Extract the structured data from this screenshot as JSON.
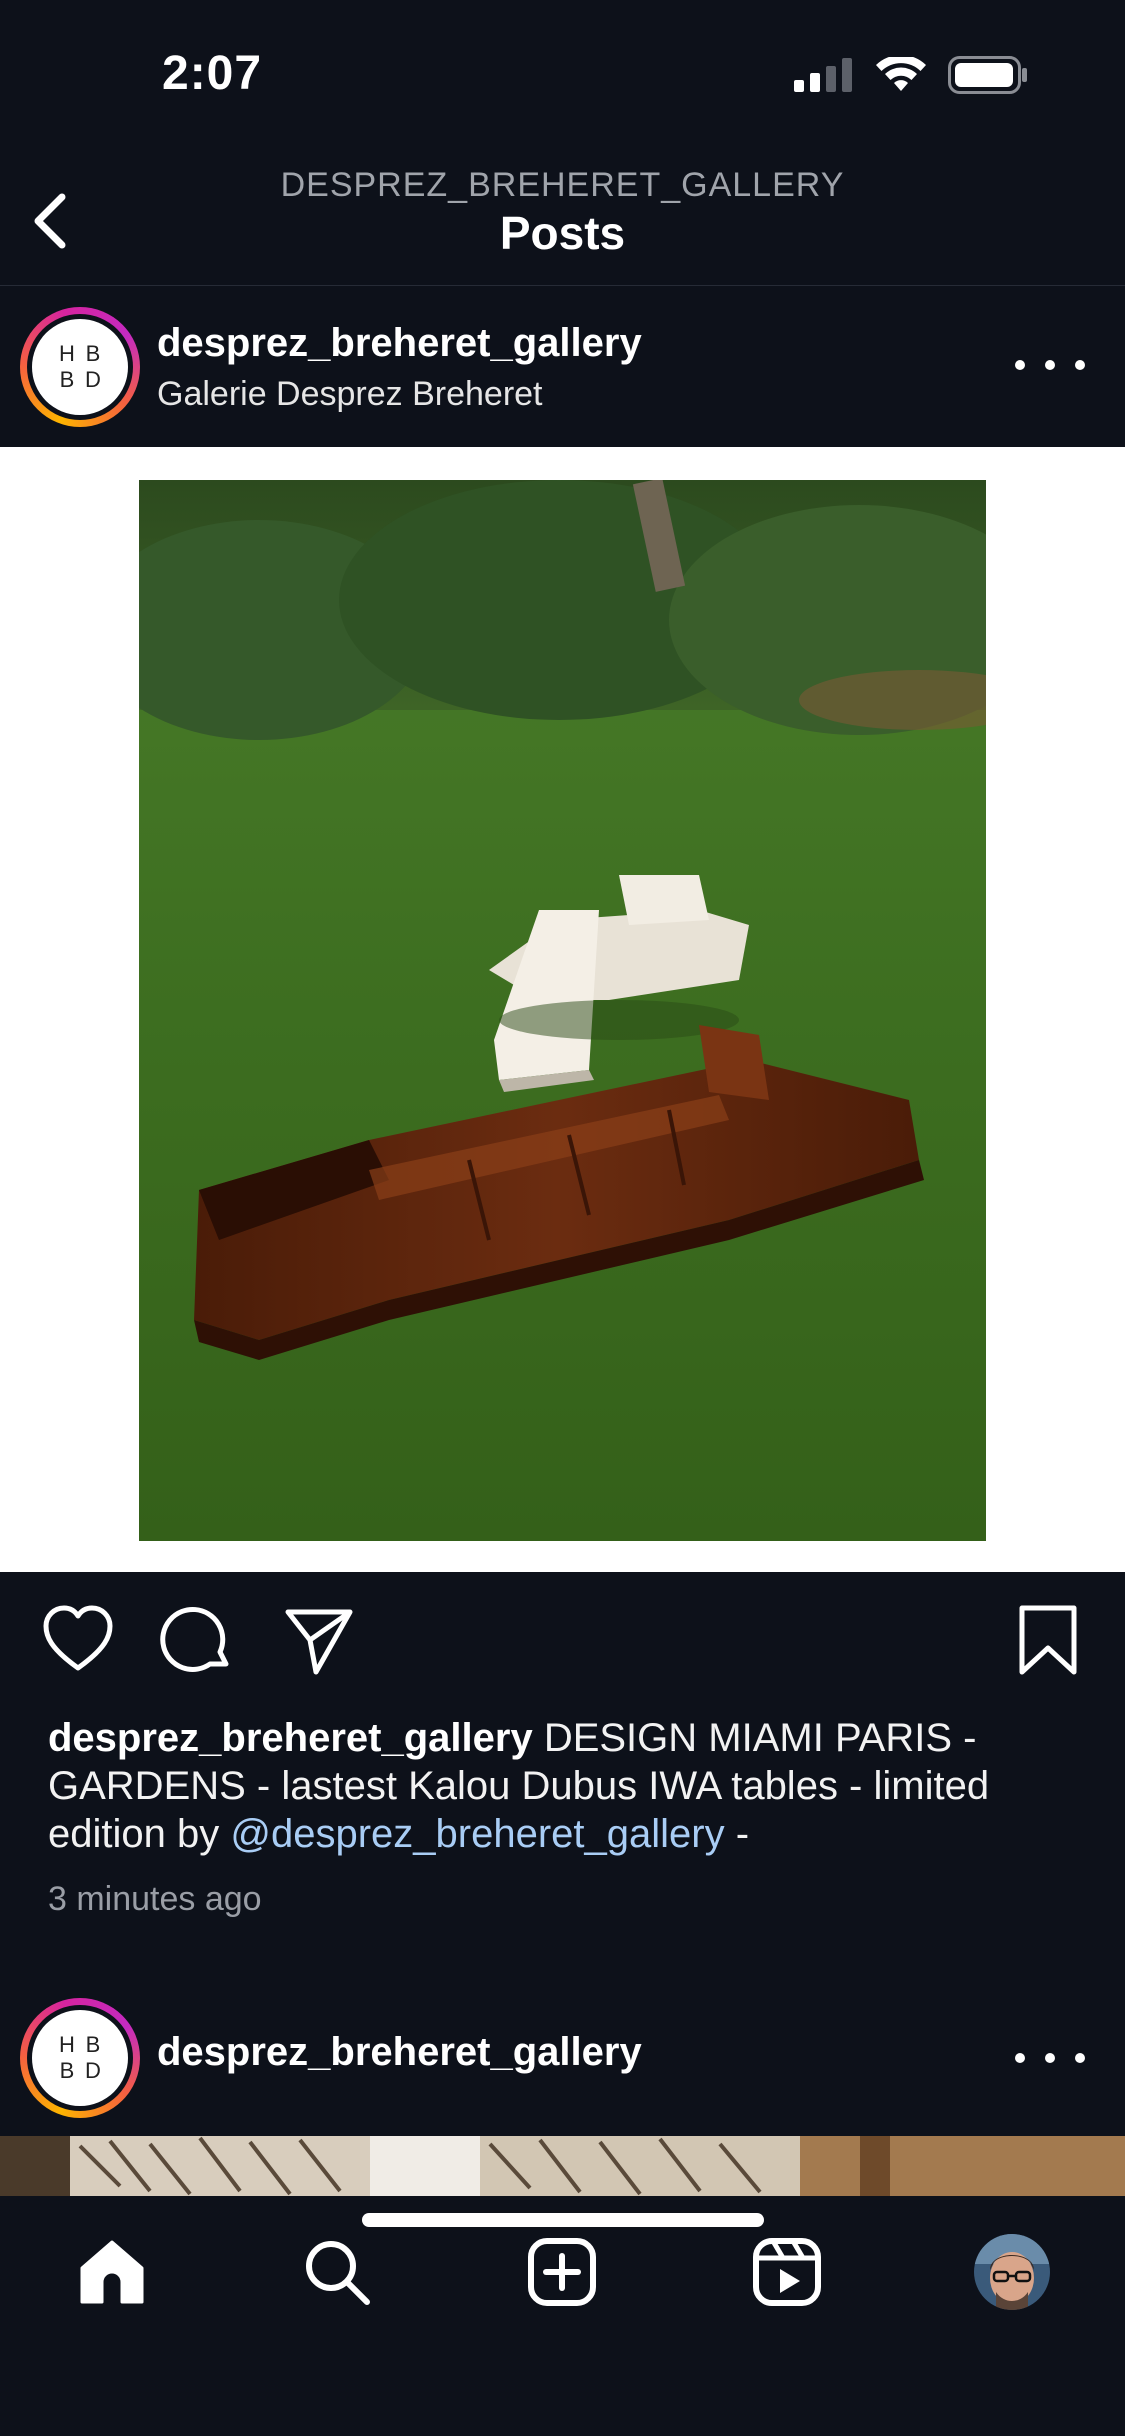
{
  "status_bar": {
    "time": "2:07"
  },
  "header": {
    "subtitle": "DESPREZ_BREHERET_GALLERY",
    "title": "Posts"
  },
  "post": {
    "avatar_letters": [
      "H",
      "B",
      "B",
      "D"
    ],
    "username": "desprez_breheret_gallery",
    "subtitle": "Galerie Desprez Breheret",
    "caption": {
      "username": "desprez_breheret_gallery",
      "text": "DESIGN MIAMI PARIS - GARDENS - lastest Kalou Dubus IWA tables - limited edition by",
      "mention": "@desprez_breheret_gallery",
      "trailing": "-"
    },
    "timestamp": "3 minutes ago"
  },
  "next_post": {
    "avatar_letters": [
      "H",
      "B",
      "B",
      "D"
    ],
    "username": "desprez_breheret_gallery"
  },
  "tab_bar": {
    "items": [
      "home-icon",
      "search-icon",
      "create-icon",
      "reels-icon",
      "profile-avatar"
    ]
  },
  "colors": {
    "background": "#0d111a",
    "mention": "#a9cdf5",
    "secondary_text": "#9a9ea6"
  }
}
